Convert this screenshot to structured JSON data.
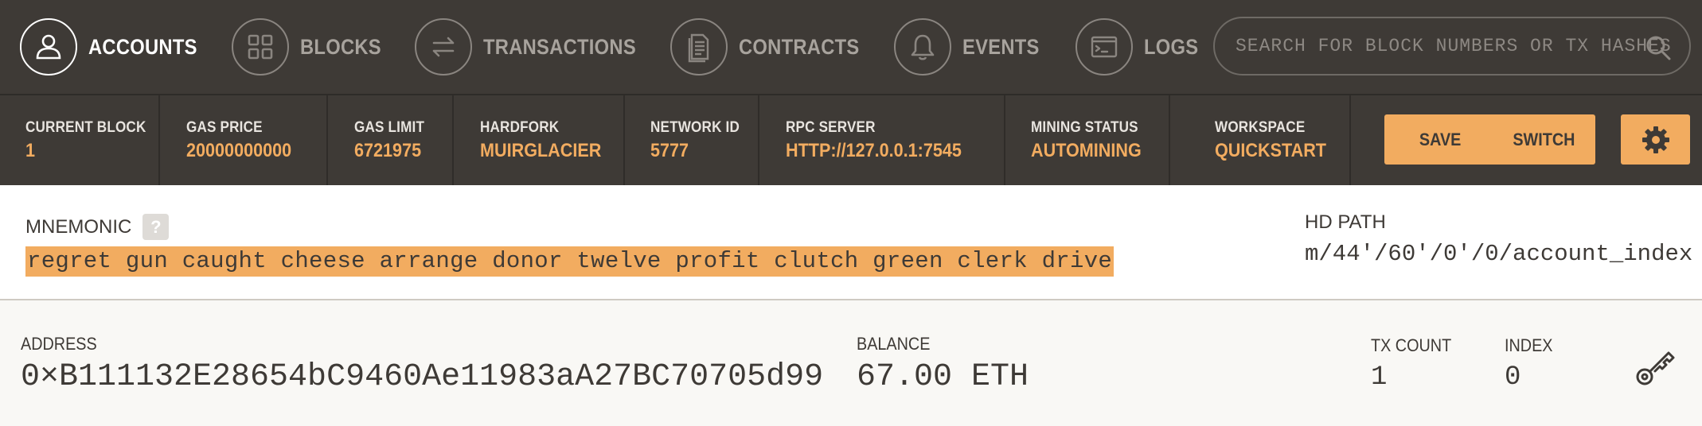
{
  "nav": {
    "items": [
      {
        "label": "ACCOUNTS",
        "icon": "user-icon",
        "active": true
      },
      {
        "label": "BLOCKS",
        "icon": "grid-icon",
        "active": false
      },
      {
        "label": "TRANSACTIONS",
        "icon": "arrows-icon",
        "active": false
      },
      {
        "label": "CONTRACTS",
        "icon": "document-icon",
        "active": false
      },
      {
        "label": "EVENTS",
        "icon": "bell-icon",
        "active": false
      },
      {
        "label": "LOGS",
        "icon": "terminal-icon",
        "active": false
      }
    ],
    "search_placeholder": "SEARCH FOR BLOCK NUMBERS OR TX HASHES"
  },
  "status": {
    "current_block": {
      "label": "CURRENT BLOCK",
      "value": "1"
    },
    "gas_price": {
      "label": "GAS PRICE",
      "value": "20000000000"
    },
    "gas_limit": {
      "label": "GAS LIMIT",
      "value": "6721975"
    },
    "hardfork": {
      "label": "HARDFORK",
      "value": "MUIRGLACIER"
    },
    "network_id": {
      "label": "NETWORK ID",
      "value": "5777"
    },
    "rpc_server": {
      "label": "RPC SERVER",
      "value": "HTTP://127.0.0.1:7545"
    },
    "mining_status": {
      "label": "MINING STATUS",
      "value": "AUTOMINING"
    },
    "workspace": {
      "label": "WORKSPACE",
      "value": "QUICKSTART"
    },
    "save_label": "SAVE",
    "switch_label": "SWITCH"
  },
  "mnemonic": {
    "title": "MNEMONIC",
    "help": "?",
    "phrase": "regret gun caught cheese arrange donor twelve profit clutch green clerk drive",
    "hd_path_title": "HD PATH",
    "hd_path": "m/44'/60'/0'/0/account_index"
  },
  "account": {
    "address_label": "ADDRESS",
    "address": "0×B111132E28654bC9460Ae11983aA27BC70705d99",
    "balance_label": "BALANCE",
    "balance": "67.00 ETH",
    "tx_count_label": "TX COUNT",
    "tx_count": "1",
    "index_label": "INDEX",
    "index": "0"
  },
  "colors": {
    "dark_bg": "#3e3a36",
    "accent": "#f2ac60",
    "panel_bg": "#f9f8f5"
  }
}
